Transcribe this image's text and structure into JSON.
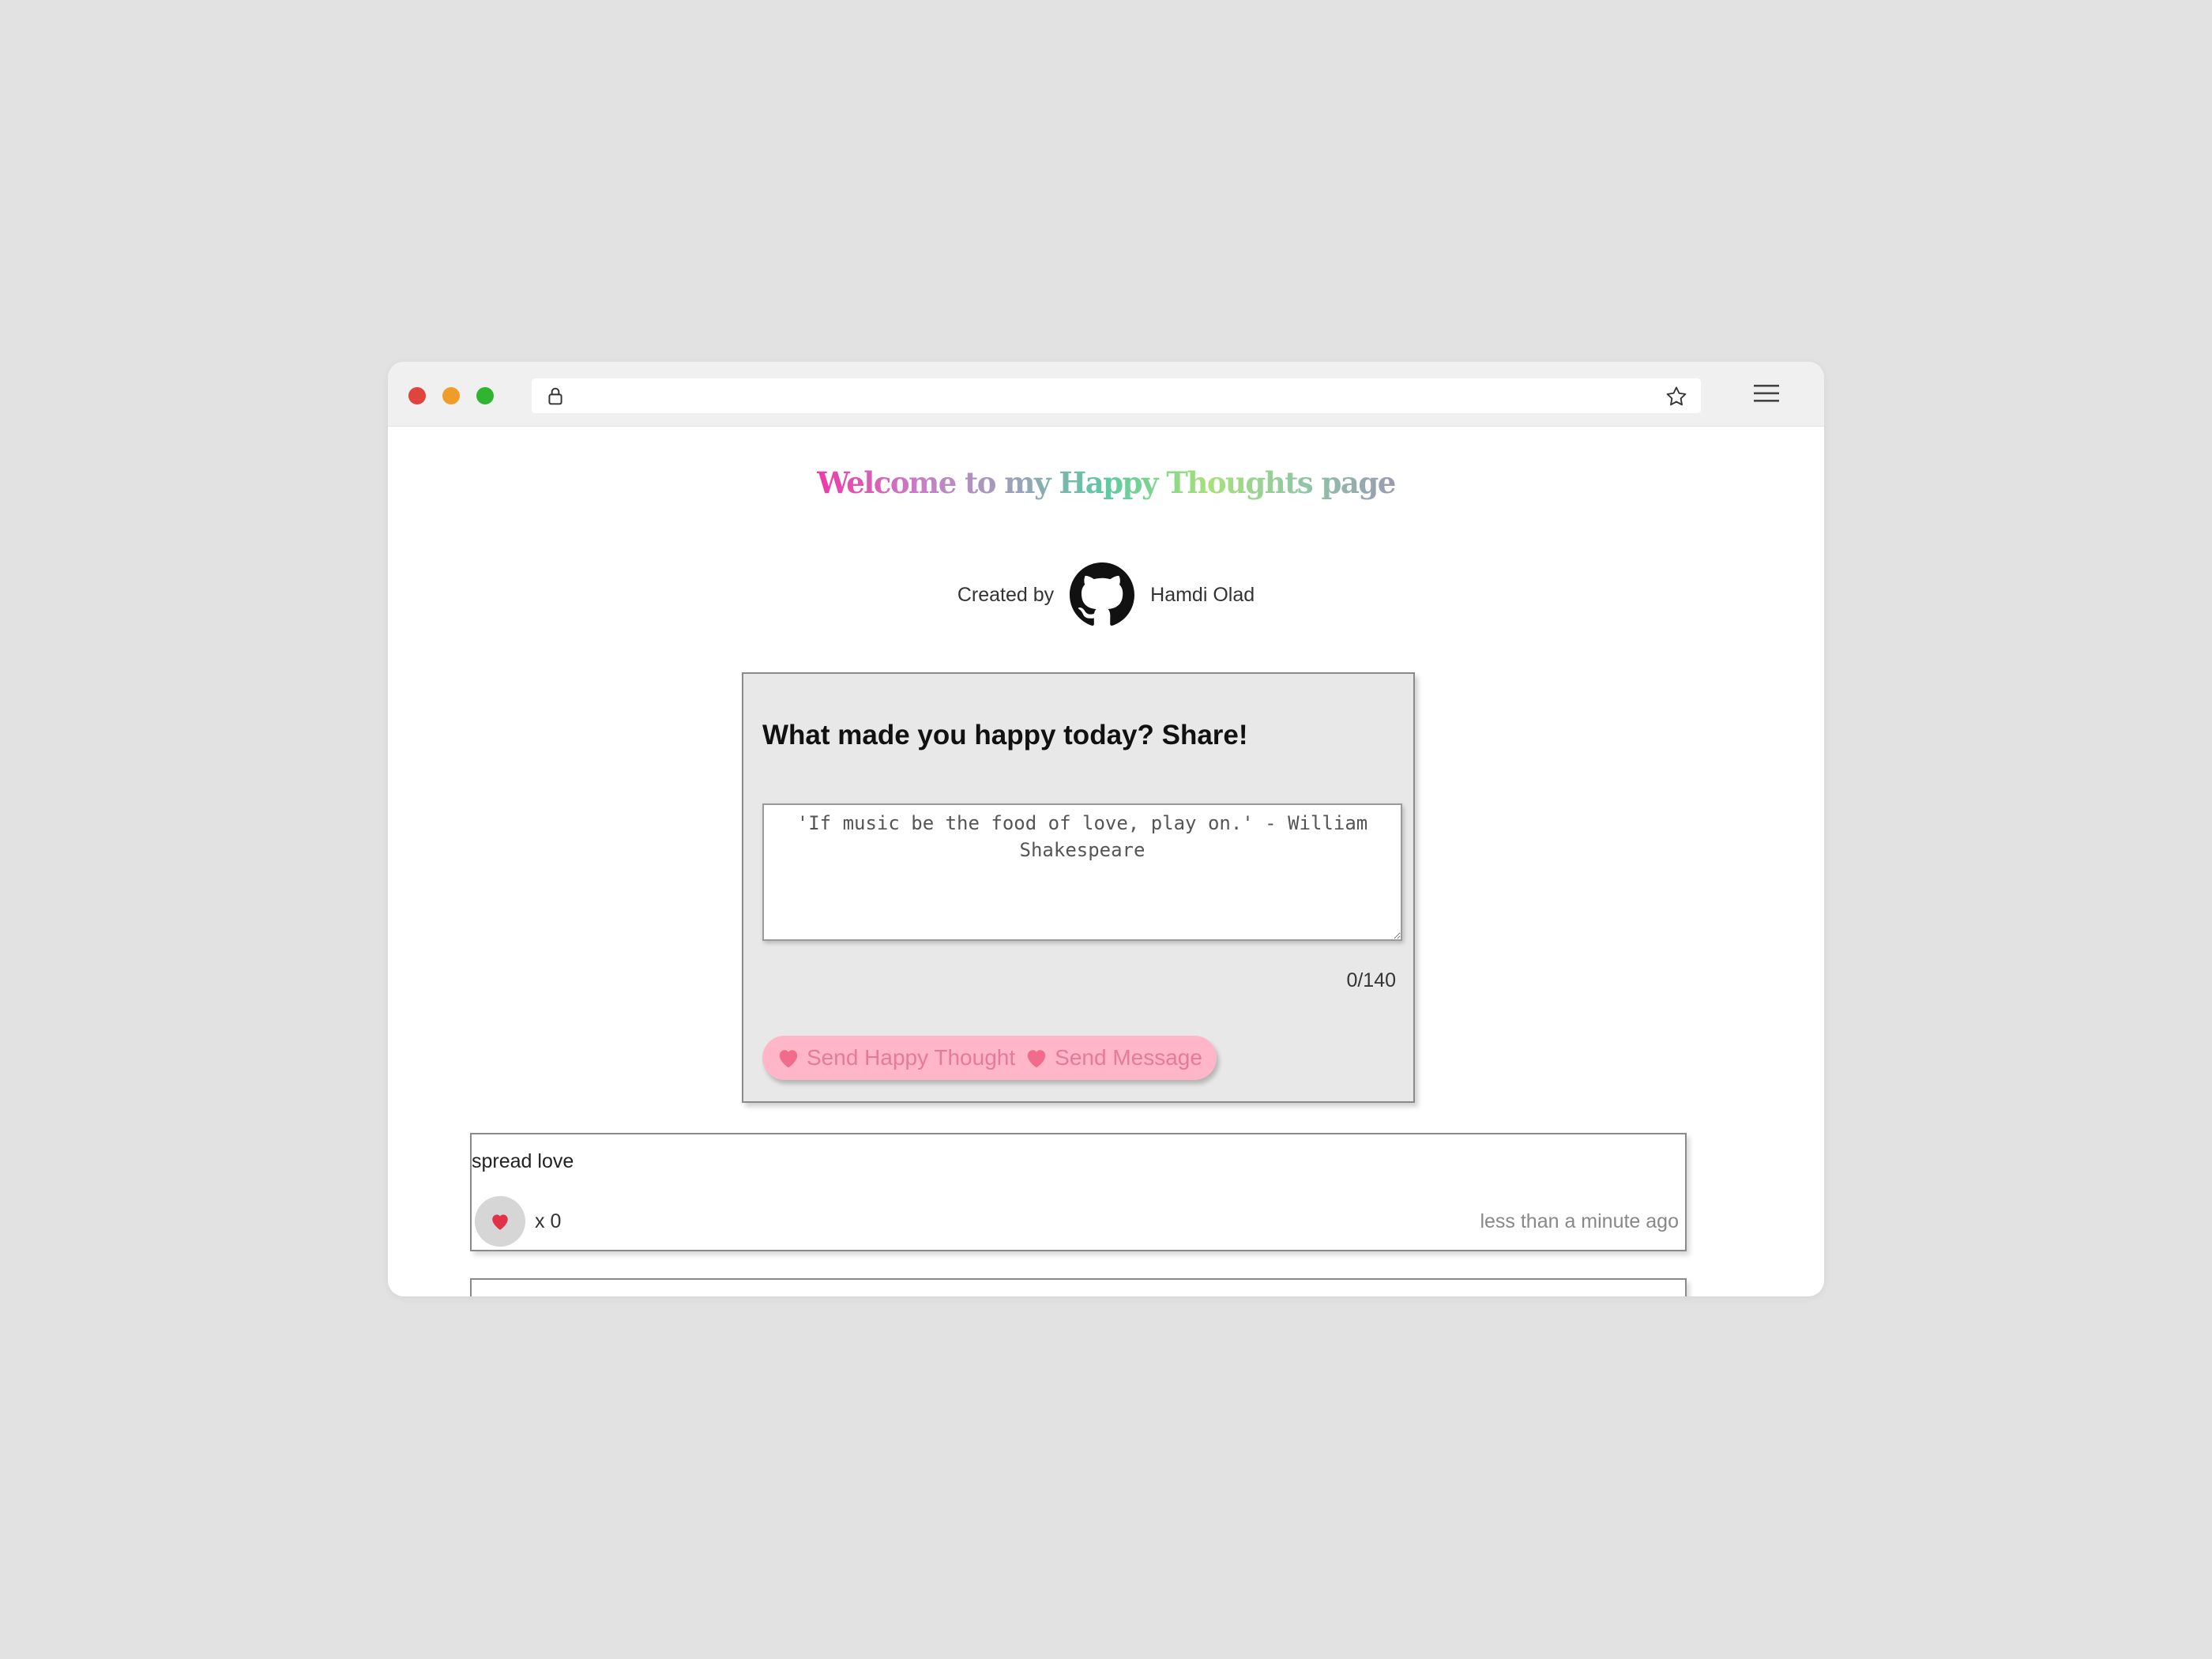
{
  "browser": {
    "icons": {
      "lock": "lock-icon",
      "star": "star-icon",
      "menu": "menu-icon"
    },
    "traffic_lights": {
      "close": "#e0443e",
      "minimize": "#f09c28",
      "maximize": "#2fb52f"
    }
  },
  "header": {
    "title_words": [
      "Welcome",
      "to",
      "my",
      "Happy",
      "Thoughts",
      "page"
    ],
    "created_by": "Created by",
    "author": "Hamdi Olad",
    "author_icon": "github-icon"
  },
  "form": {
    "heading": "What made you happy today? Share!",
    "placeholder": "'If music be the food of love, play on.' - William Shakespeare",
    "char_count": "0/140",
    "send_label_1": "Send Happy Thought",
    "send_label_2": "Send Message",
    "button_color": "#ffb6c8",
    "button_text_color": "#e67a9b"
  },
  "thoughts": [
    {
      "message": "spread love",
      "likes": "x 0",
      "time": "less than a minute ago"
    }
  ],
  "colors": {
    "heart": "#e0334a",
    "card_background": "#e8e8e8"
  }
}
